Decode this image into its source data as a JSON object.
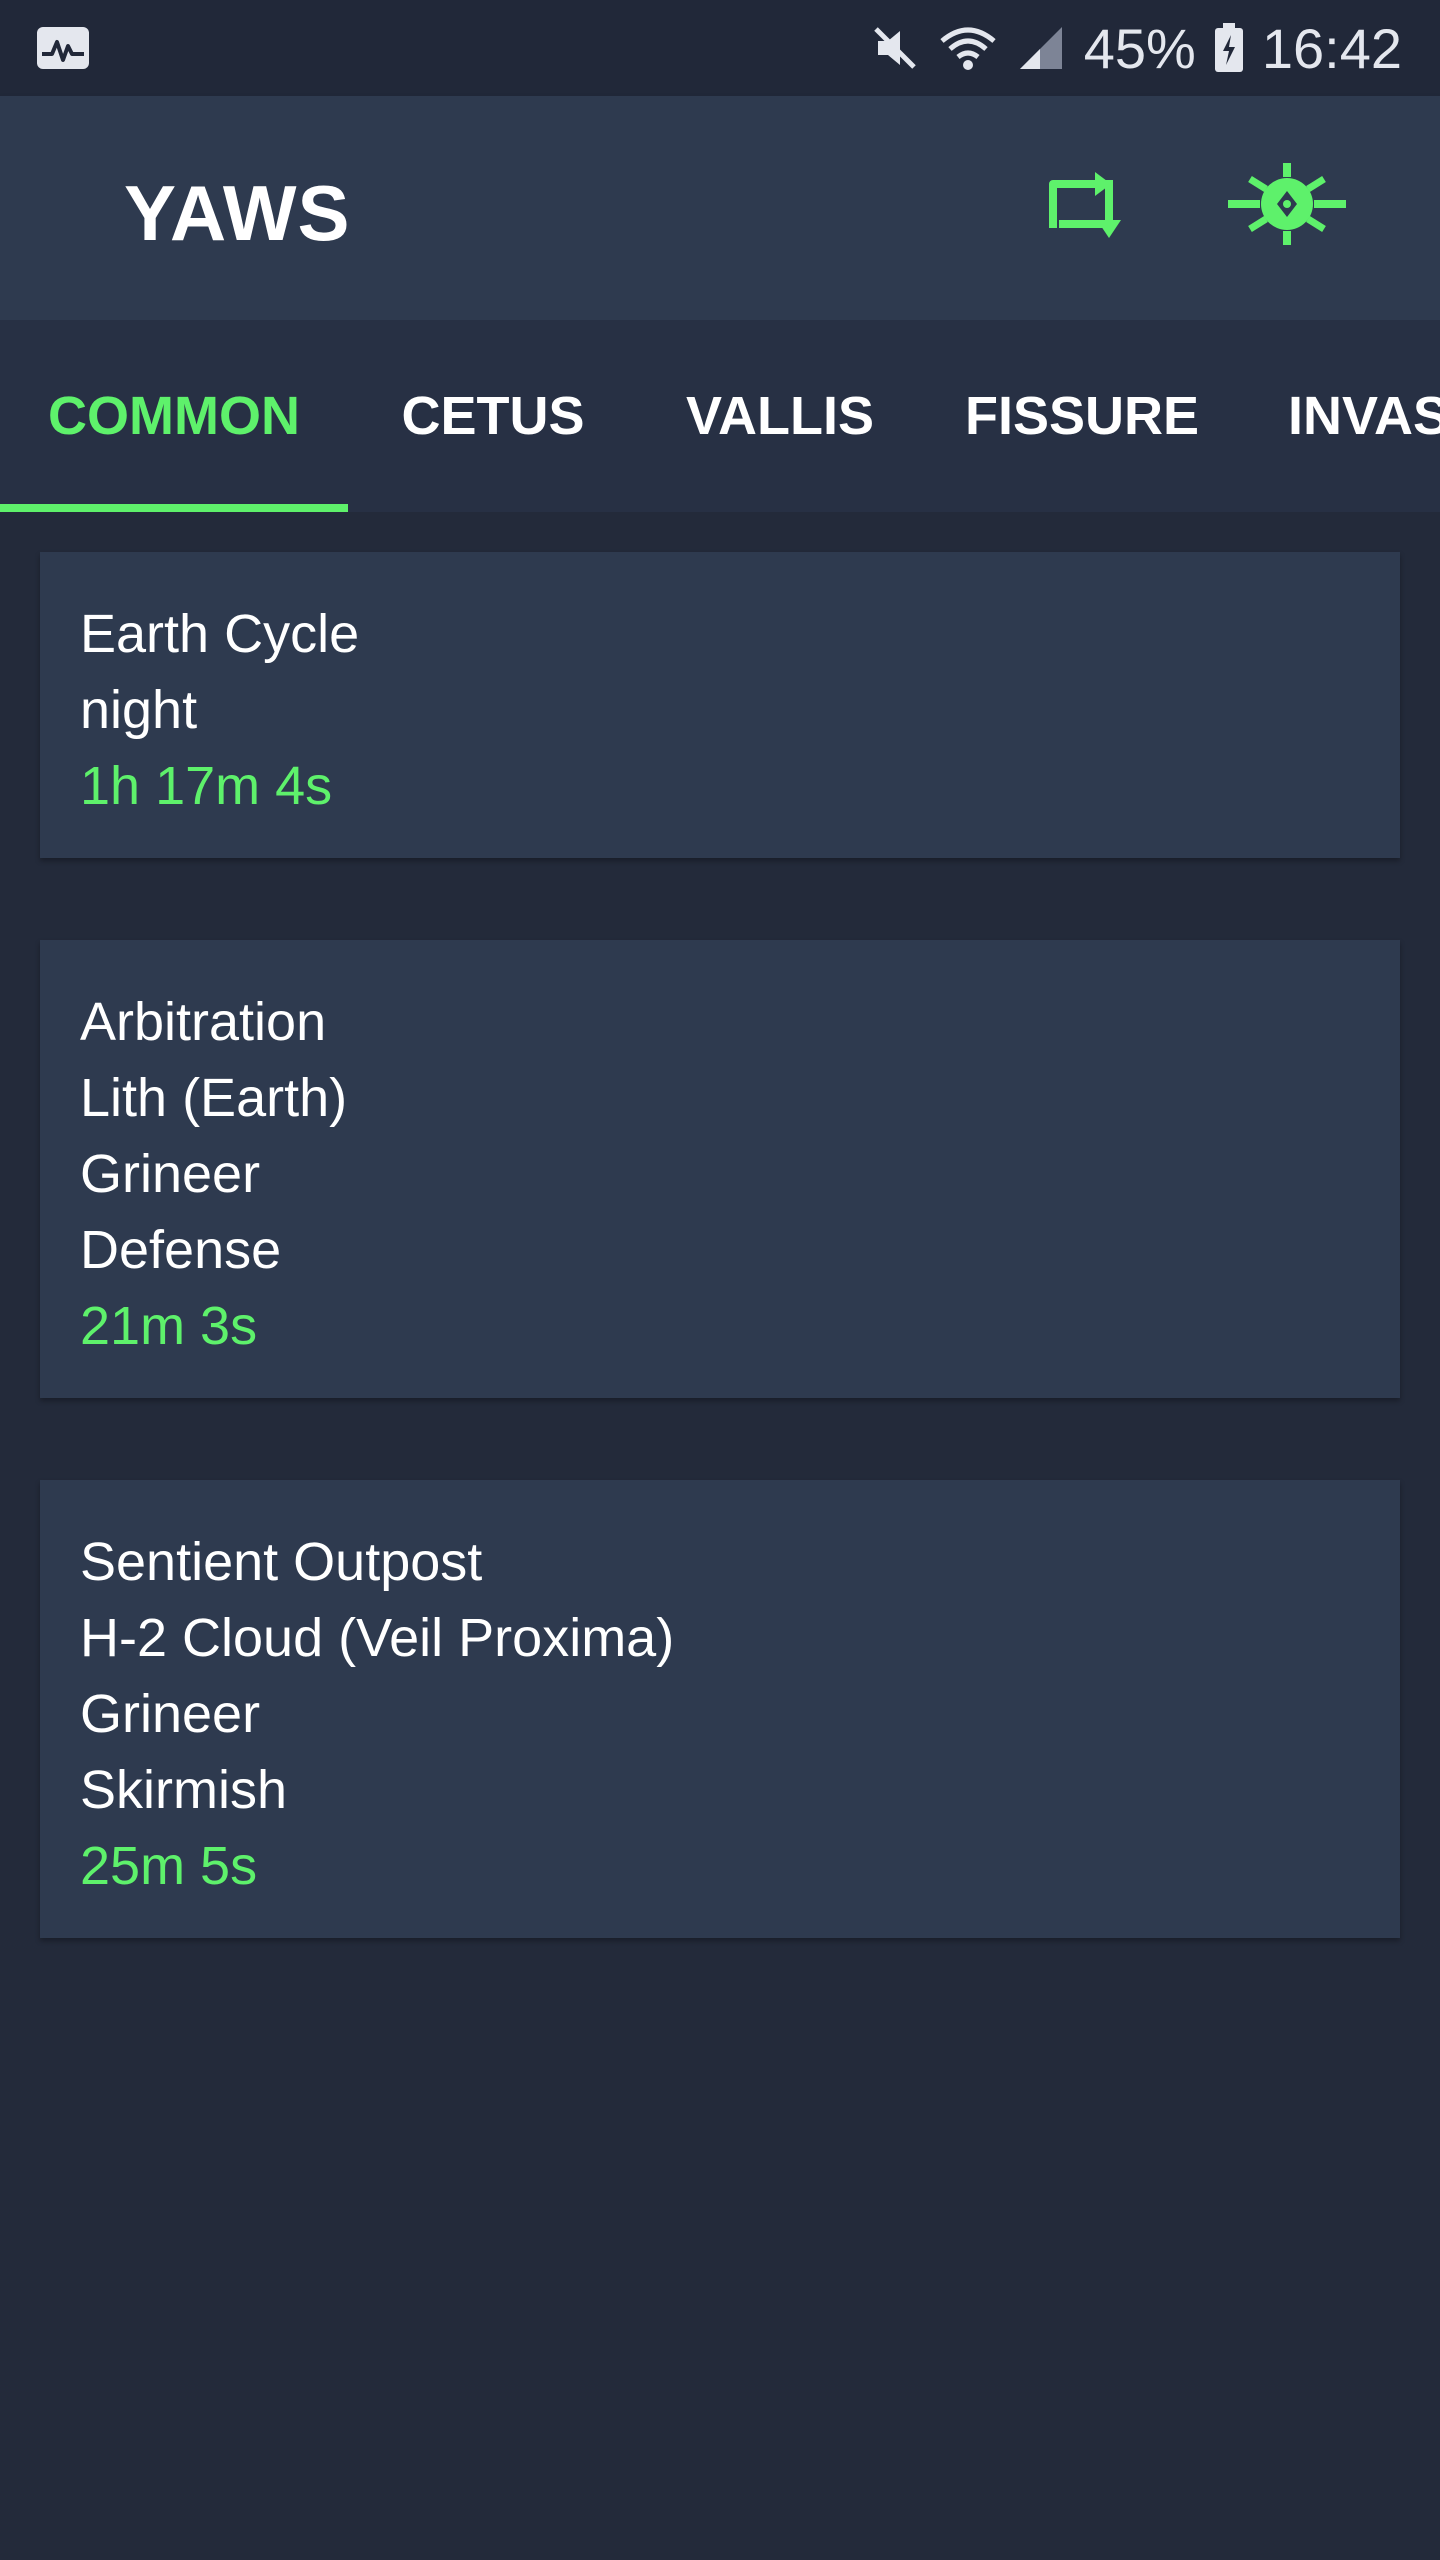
{
  "status_bar": {
    "battery": "45%",
    "time": "16:42",
    "icons": [
      "activity-icon",
      "mute-icon",
      "wifi-icon",
      "signal-icon",
      "battery-icon"
    ]
  },
  "app": {
    "title": "YAWS",
    "actions": [
      "refresh-icon",
      "settings-icon"
    ]
  },
  "tabs": [
    {
      "label": "COMMON",
      "active": true
    },
    {
      "label": "CETUS",
      "active": false
    },
    {
      "label": "VALLIS",
      "active": false
    },
    {
      "label": "FISSURE",
      "active": false
    },
    {
      "label": "INVAS",
      "active": false
    }
  ],
  "cards": [
    {
      "lines": [
        "Earth Cycle",
        "night"
      ],
      "timer": "1h 17m 4s"
    },
    {
      "lines": [
        "Arbitration",
        "Lith (Earth)",
        "Grineer",
        "Defense"
      ],
      "timer": "21m 3s"
    },
    {
      "lines": [
        "Sentient Outpost",
        "H-2 Cloud (Veil Proxima)",
        "Grineer",
        "Skirmish"
      ],
      "timer": "25m 5s"
    }
  ],
  "colors": {
    "accent": "#5ef16b",
    "background": "#232a3a",
    "surface": "#2e3a4f",
    "tabbar": "#273044"
  }
}
